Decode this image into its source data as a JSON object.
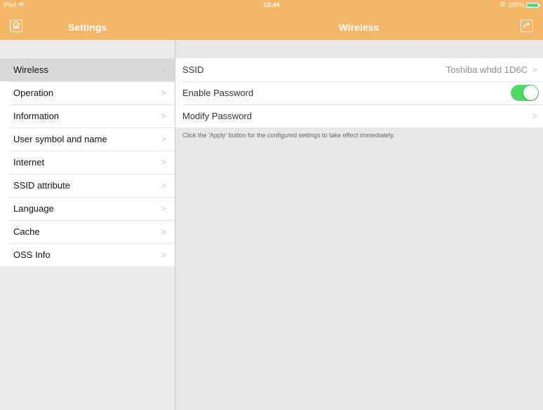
{
  "status": {
    "device": "iPad",
    "time": "10:44",
    "battery": "100%"
  },
  "nav": {
    "left_title": "Settings",
    "right_title": "Wireless"
  },
  "sidebar": {
    "items": [
      {
        "label": "Wireless",
        "active": true
      },
      {
        "label": "Operation"
      },
      {
        "label": "Information"
      },
      {
        "label": "User symbol and name"
      },
      {
        "label": "Internet"
      },
      {
        "label": "SSID attribute"
      },
      {
        "label": "Language"
      },
      {
        "label": "Cache"
      },
      {
        "label": "OSS Info"
      }
    ]
  },
  "detail": {
    "ssid_label": "SSID",
    "ssid_value": "Toshiba whdd 1D6C",
    "enable_password_label": "Enable Password",
    "enable_password_on": true,
    "modify_password_label": "Modify Password",
    "note": "Click the 'Apply' button for the configured settings to take effect immediately."
  },
  "colors": {
    "accent": "#f5b666",
    "toggle_on": "#4cd964",
    "battery": "#4cd964"
  },
  "icons": {
    "home": "home-icon",
    "share": "share-icon",
    "wifi": "wifi-icon",
    "chevron": "chevron-right-icon"
  }
}
